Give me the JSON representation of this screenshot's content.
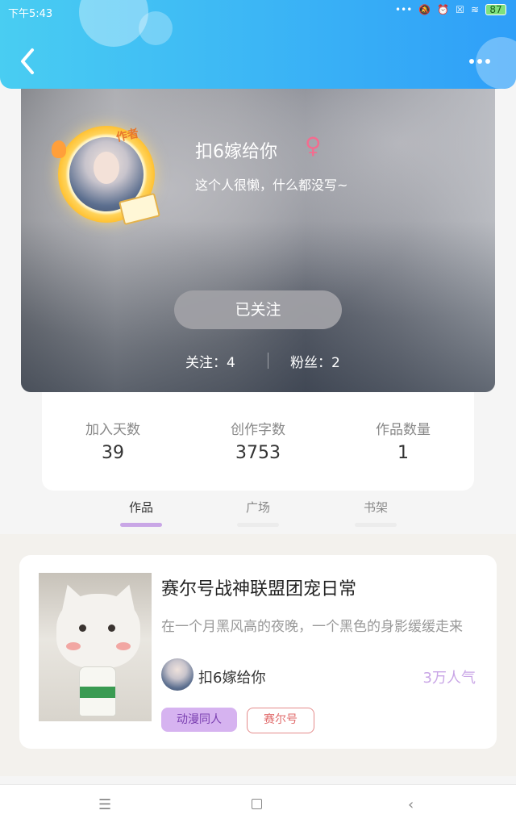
{
  "status_bar": {
    "time": "下午5:43",
    "icons": [
      "signal-dots",
      "mute-icon",
      "alarm-icon",
      "close-box-icon",
      "wifi-icon"
    ],
    "battery_level": "87"
  },
  "header": {
    "back_icon": "chevron-left-icon",
    "more_icon": "more-dots-icon",
    "gradient": [
      "#49cdf2",
      "#2f9ff8"
    ]
  },
  "profile": {
    "badge_text": "作者",
    "username": "扣6嫁给你",
    "gender_symbol": "♀",
    "bio": "这个人很懒，什么都没写~",
    "follow_button": "已关注",
    "following": "关注：4",
    "fans": "粉丝：2"
  },
  "stats": [
    {
      "label": "加入天数",
      "value": "39"
    },
    {
      "label": "创作字数",
      "value": "3753"
    },
    {
      "label": "作品数量",
      "value": "1"
    }
  ],
  "tabs": [
    {
      "label": "作品",
      "active": true
    },
    {
      "label": "广场",
      "active": false
    },
    {
      "label": "书架",
      "active": false
    }
  ],
  "work": {
    "title": "赛尔号战神联盟团宠日常",
    "description": "在一个月黑风高的夜晚，一个黑色的身影缓缓走来",
    "author": "扣6嫁给你",
    "popularity": "3万人气",
    "tags": [
      "动漫同人",
      "赛尔号"
    ],
    "accent_color": "#c9a6e6"
  },
  "navbar": {
    "menu_glyph": "☰",
    "back_glyph": "‹"
  }
}
